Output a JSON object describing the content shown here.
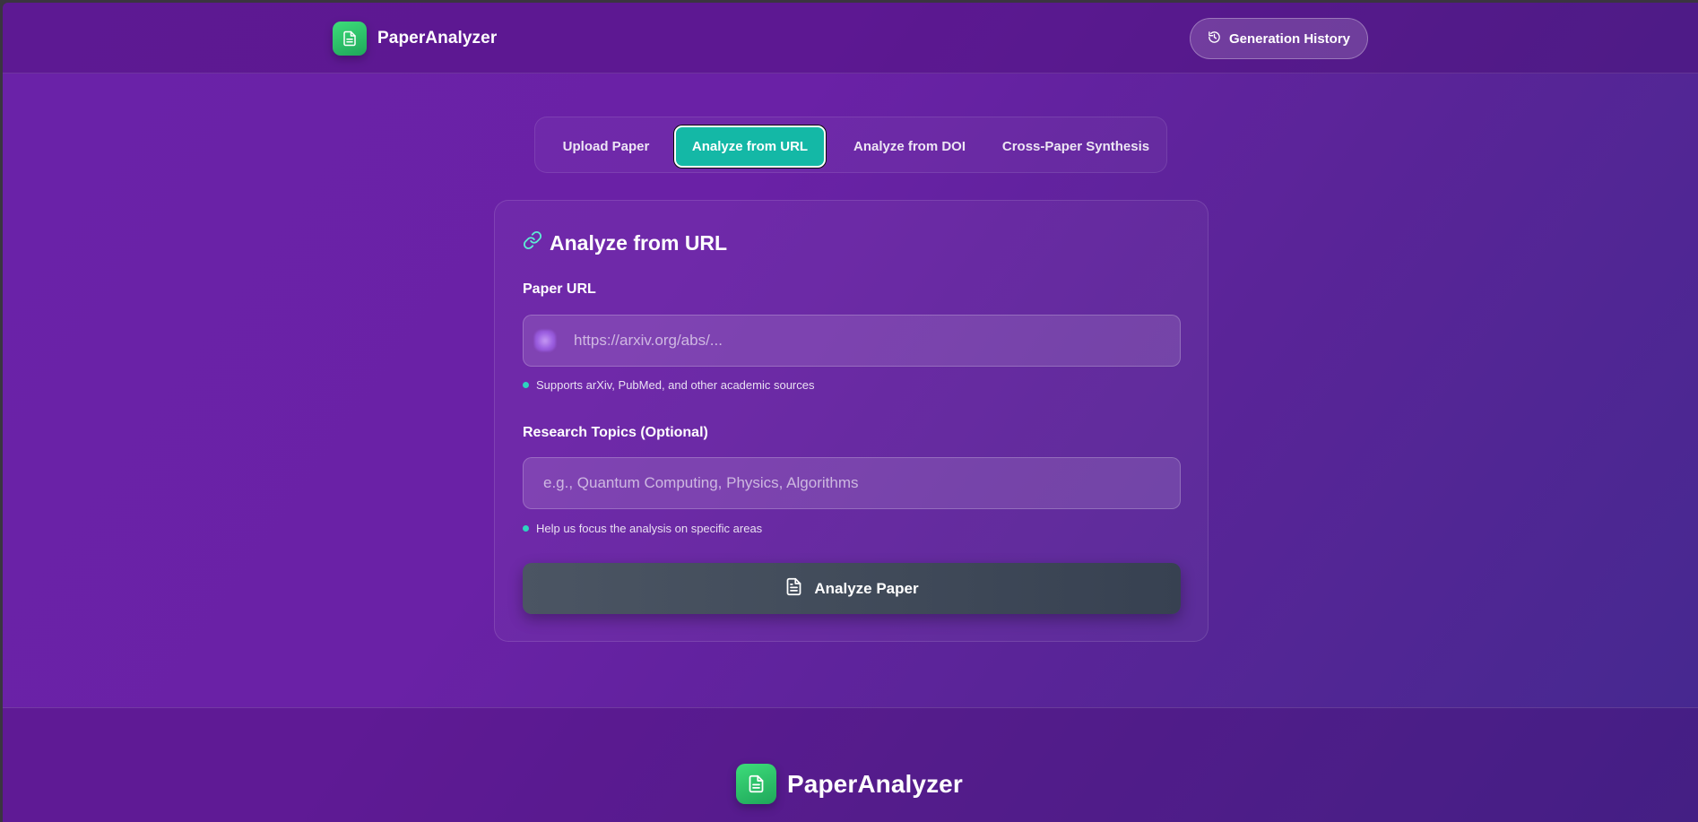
{
  "header": {
    "brand": "PaperAnalyzer",
    "history_button": "Generation History"
  },
  "tabs": [
    {
      "label": "Upload Paper",
      "active": false
    },
    {
      "label": "Analyze from URL",
      "active": true
    },
    {
      "label": "Analyze from DOI",
      "active": false
    },
    {
      "label": "Cross-Paper Synthesis",
      "active": false
    }
  ],
  "card": {
    "title": "Analyze from URL",
    "url_label": "Paper URL",
    "url_placeholder": "https://arxiv.org/abs/...",
    "url_hint": "Supports arXiv, PubMed, and other academic sources",
    "topics_label": "Research Topics (Optional)",
    "topics_placeholder": "e.g., Quantum Computing, Physics, Algorithms",
    "topics_hint": "Help us focus the analysis on specific areas",
    "analyze_button": "Analyze Paper"
  },
  "footer": {
    "brand": "PaperAnalyzer"
  },
  "colors": {
    "accent": "#14b8a6",
    "logo_green": "#22c55e",
    "background": "#6a21a6",
    "button_gray": "#4b5563"
  },
  "icons": {
    "brand": "document-icon",
    "history": "history-icon",
    "card_title": "link-icon",
    "analyze": "document-icon"
  }
}
